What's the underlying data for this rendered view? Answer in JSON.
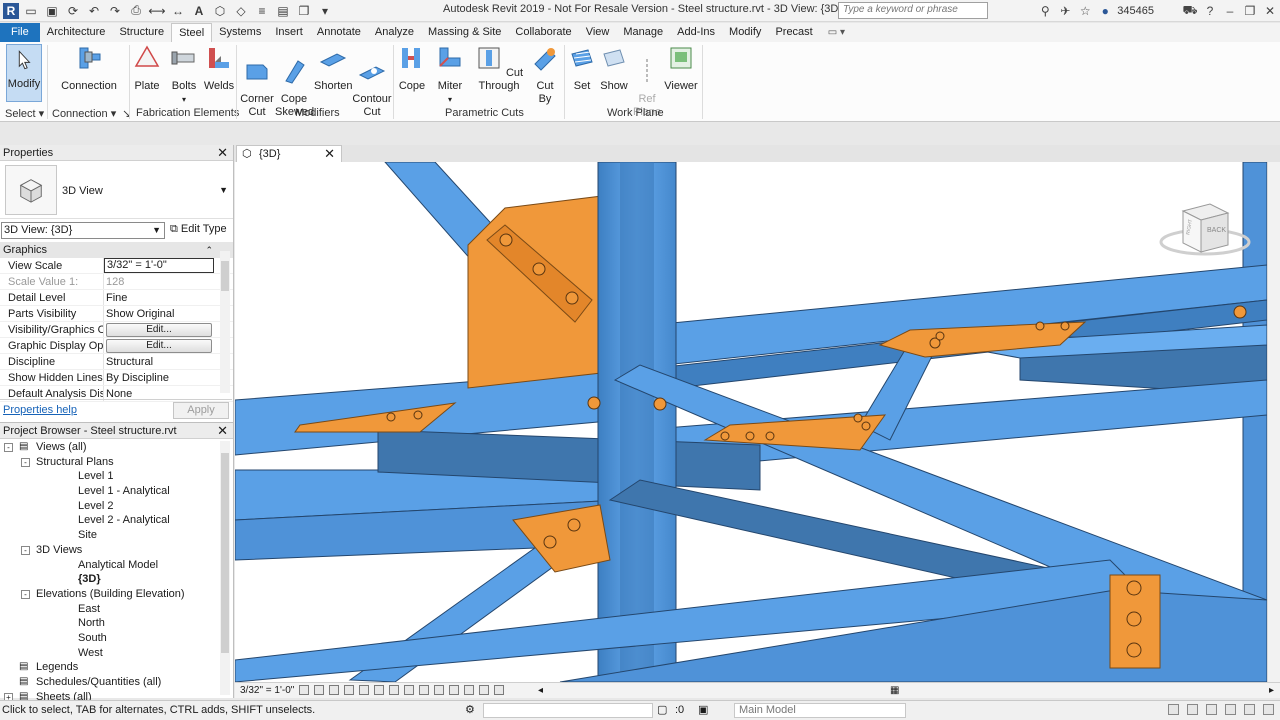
{
  "app": {
    "title": "Autodesk Revit 2019 - Not For Resale Version - Steel structure.rvt - 3D View: {3D}",
    "search_placeholder": "Type a keyword or phrase",
    "user": "345465"
  },
  "tabs": [
    "File",
    "Architecture",
    "Structure",
    "Steel",
    "Systems",
    "Insert",
    "Annotate",
    "Analyze",
    "Massing & Site",
    "Collaborate",
    "View",
    "Manage",
    "Add-Ins",
    "Modify",
    "Precast"
  ],
  "active_tab": "Steel",
  "ribbon": {
    "modify": "Modify",
    "connection": "Connection",
    "plate": "Plate",
    "bolts": "Bolts",
    "welds": "Welds",
    "corner_cut": "Corner\nCut",
    "cope_skewed": "Cope\nSkewed",
    "shorten": "Shorten",
    "contour_cut": "Contour\nCut",
    "cope": "Cope",
    "miter": "Miter",
    "cut_through": "Cut Through",
    "cut_by": "Cut By",
    "set": "Set",
    "show": "Show",
    "ref_plane": "Ref\nPlane",
    "viewer": "Viewer",
    "panels": {
      "select": "Select",
      "connection": "Connection",
      "fabrication": "Fabrication Elements",
      "modifiers": "Modifiers",
      "parametric": "Parametric Cuts",
      "work_plane": "Work Plane"
    }
  },
  "properties": {
    "title": "Properties",
    "type_name": "3D View",
    "instance": "3D View: {3D}",
    "edit_type": "Edit Type",
    "group": "Graphics",
    "rows": [
      {
        "k": "View Scale",
        "v": "3/32\" = 1'-0\""
      },
      {
        "k": "Scale Value    1:",
        "v": "128"
      },
      {
        "k": "Detail Level",
        "v": "Fine"
      },
      {
        "k": "Parts Visibility",
        "v": "Show Original"
      },
      {
        "k": "Visibility/Graphics O...",
        "v": "Edit..."
      },
      {
        "k": "Graphic Display Opt...",
        "v": "Edit..."
      },
      {
        "k": "Discipline",
        "v": "Structural"
      },
      {
        "k": "Show Hidden Lines",
        "v": "By Discipline"
      },
      {
        "k": "Default Analysis Dis...",
        "v": "None"
      }
    ],
    "help_link": "Properties help",
    "apply": "Apply"
  },
  "browser": {
    "title": "Project Browser - Steel structure.rvt",
    "nodes": [
      {
        "label": "Views (all)",
        "level": 0,
        "toggle": "-",
        "icon": true
      },
      {
        "label": "Structural Plans",
        "level": 1,
        "toggle": "-"
      },
      {
        "label": "Level 1",
        "level": 2
      },
      {
        "label": "Level 1 - Analytical",
        "level": 2
      },
      {
        "label": "Level 2",
        "level": 2
      },
      {
        "label": "Level 2 - Analytical",
        "level": 2
      },
      {
        "label": "Site",
        "level": 2
      },
      {
        "label": "3D Views",
        "level": 1,
        "toggle": "-"
      },
      {
        "label": "Analytical Model",
        "level": 2
      },
      {
        "label": "{3D}",
        "level": 2,
        "selected": true
      },
      {
        "label": "Elevations (Building Elevation)",
        "level": 1,
        "toggle": "-"
      },
      {
        "label": "East",
        "level": 2
      },
      {
        "label": "North",
        "level": 2
      },
      {
        "label": "South",
        "level": 2
      },
      {
        "label": "West",
        "level": 2
      },
      {
        "label": "Legends",
        "level": 0,
        "icon": true
      },
      {
        "label": "Schedules/Quantities (all)",
        "level": 0,
        "icon": true
      },
      {
        "label": "Sheets (all)",
        "level": 0,
        "toggle": "+",
        "icon": true
      }
    ]
  },
  "view": {
    "tab": "{3D}",
    "scale": "3/32\" = 1'-0\"",
    "viewcube_label": "BACK",
    "viewcube_side": "RIGHT"
  },
  "status": {
    "message": "Click to select, TAB for alternates, CTRL adds, SHIFT unselects.",
    "count": ":0",
    "model": "Main Model"
  },
  "colors": {
    "steel_blue": "#5aa0e6",
    "plate_orange": "#f0983a",
    "accent": "#1e73be"
  }
}
